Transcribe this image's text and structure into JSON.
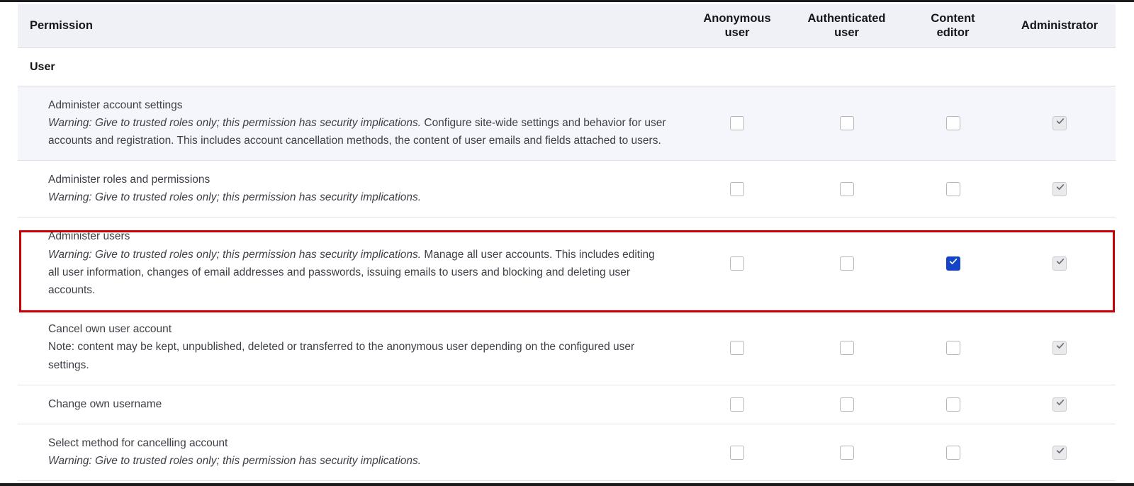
{
  "table": {
    "columns": [
      {
        "key": "permission",
        "label": "Permission",
        "align": "left"
      },
      {
        "key": "anonymous",
        "label_line1": "Anonymous",
        "label_line2": "user"
      },
      {
        "key": "authenticated",
        "label_line1": "Authenticated",
        "label_line2": "user"
      },
      {
        "key": "content_editor",
        "label_line1": "Content",
        "label_line2": "editor"
      },
      {
        "key": "administrator",
        "label_line1": "Administrator",
        "label_line2": ""
      }
    ],
    "section": {
      "label": "User"
    },
    "rows": [
      {
        "title": "Administer account settings",
        "warning": "Warning: Give to trusted roles only; this permission has security implications.",
        "description": " Configure site-wide settings and behavior for user accounts and registration. This includes account cancellation methods, the content of user emails and fields attached to users.",
        "note": "",
        "shaded": true,
        "highlighted": false,
        "states": [
          "unchecked",
          "unchecked",
          "unchecked",
          "disabled-checked"
        ]
      },
      {
        "title": "Administer roles and permissions",
        "warning": "Warning: Give to trusted roles only; this permission has security implications.",
        "description": "",
        "note": "",
        "shaded": false,
        "highlighted": false,
        "states": [
          "unchecked",
          "unchecked",
          "unchecked",
          "disabled-checked"
        ]
      },
      {
        "title": "Administer users",
        "warning": "Warning: Give to trusted roles only; this permission has security implications.",
        "description": " Manage all user accounts. This includes editing all user information, changes of email addresses and passwords, issuing emails to users and blocking and deleting user accounts.",
        "note": "",
        "shaded": false,
        "highlighted": true,
        "states": [
          "unchecked",
          "unchecked",
          "checked",
          "disabled-checked"
        ]
      },
      {
        "title": "Cancel own user account",
        "warning": "",
        "description": "",
        "note": "Note: content may be kept, unpublished, deleted or transferred to the anonymous user depending on the configured user settings.",
        "shaded": false,
        "highlighted": false,
        "states": [
          "unchecked",
          "unchecked",
          "unchecked",
          "disabled-checked"
        ]
      },
      {
        "title": "Change own username",
        "warning": "",
        "description": "",
        "note": "",
        "shaded": false,
        "highlighted": false,
        "states": [
          "unchecked",
          "unchecked",
          "unchecked",
          "disabled-checked"
        ]
      },
      {
        "title": "Select method for cancelling account",
        "warning": "Warning: Give to trusted roles only; this permission has security implications.",
        "description": "",
        "note": "",
        "shaded": false,
        "highlighted": false,
        "states": [
          "unchecked",
          "unchecked",
          "unchecked",
          "disabled-checked"
        ]
      }
    ]
  },
  "colors": {
    "checked_checkbox": "#1544c8",
    "disabled_checkbox": "#eaeaec",
    "highlight_border": "#cc0000",
    "header_background": "#f0f1f6",
    "shaded_row_background": "#f4f6fb",
    "text": "#3c3f46"
  }
}
